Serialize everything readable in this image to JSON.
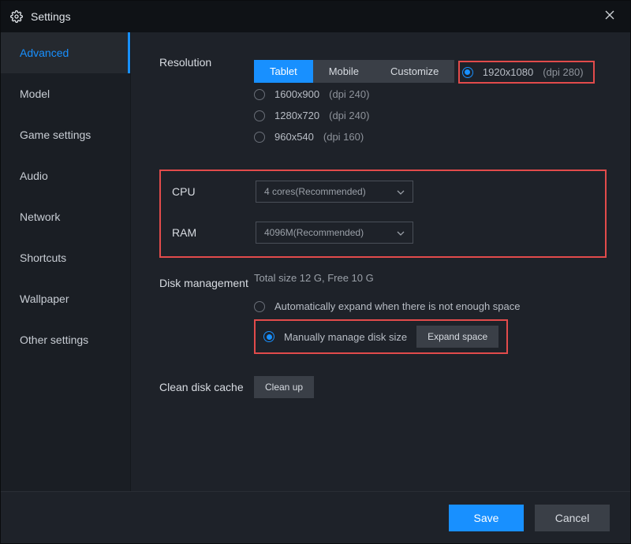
{
  "title": "Settings",
  "sidebar": {
    "items": [
      {
        "label": "Advanced",
        "active": true
      },
      {
        "label": "Model"
      },
      {
        "label": "Game settings"
      },
      {
        "label": "Audio"
      },
      {
        "label": "Network"
      },
      {
        "label": "Shortcuts"
      },
      {
        "label": "Wallpaper"
      },
      {
        "label": "Other settings"
      }
    ]
  },
  "resolution": {
    "label": "Resolution",
    "tabs": [
      {
        "label": "Tablet",
        "active": true
      },
      {
        "label": "Mobile"
      },
      {
        "label": "Customize"
      }
    ],
    "options": [
      {
        "res": "1920x1080",
        "dpi": "(dpi 280)",
        "checked": true
      },
      {
        "res": "1600x900",
        "dpi": "(dpi 240)"
      },
      {
        "res": "1280x720",
        "dpi": "(dpi 240)"
      },
      {
        "res": "960x540",
        "dpi": "(dpi 160)"
      }
    ]
  },
  "cpu": {
    "label": "CPU",
    "value": "4 cores(Recommended)"
  },
  "ram": {
    "label": "RAM",
    "value": "4096M(Recommended)"
  },
  "disk": {
    "label": "Disk management",
    "info": "Total size 12 G,   Free 10 G",
    "auto": "Automatically expand when there is not enough space",
    "manual": "Manually manage disk size",
    "expand_btn": "Expand space"
  },
  "clean": {
    "label": "Clean disk cache",
    "btn": "Clean up"
  },
  "footer": {
    "save": "Save",
    "cancel": "Cancel"
  }
}
